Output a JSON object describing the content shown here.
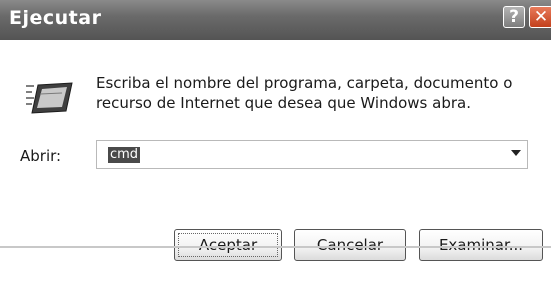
{
  "window": {
    "title": "Ejecutar",
    "help_label": "?",
    "close_label": "✕"
  },
  "content": {
    "description": "Escriba el nombre del programa, carpeta, documento o recurso de Internet que desea que Windows abra.",
    "open_label": "Abrir:",
    "open_value": "cmd"
  },
  "buttons": {
    "accept": "Aceptar",
    "cancel": "Cancelar",
    "browse": "Examinar..."
  },
  "icons": {
    "run": "run-icon",
    "dropdown": "chevron-down-icon",
    "help": "help-icon",
    "close": "close-icon"
  }
}
